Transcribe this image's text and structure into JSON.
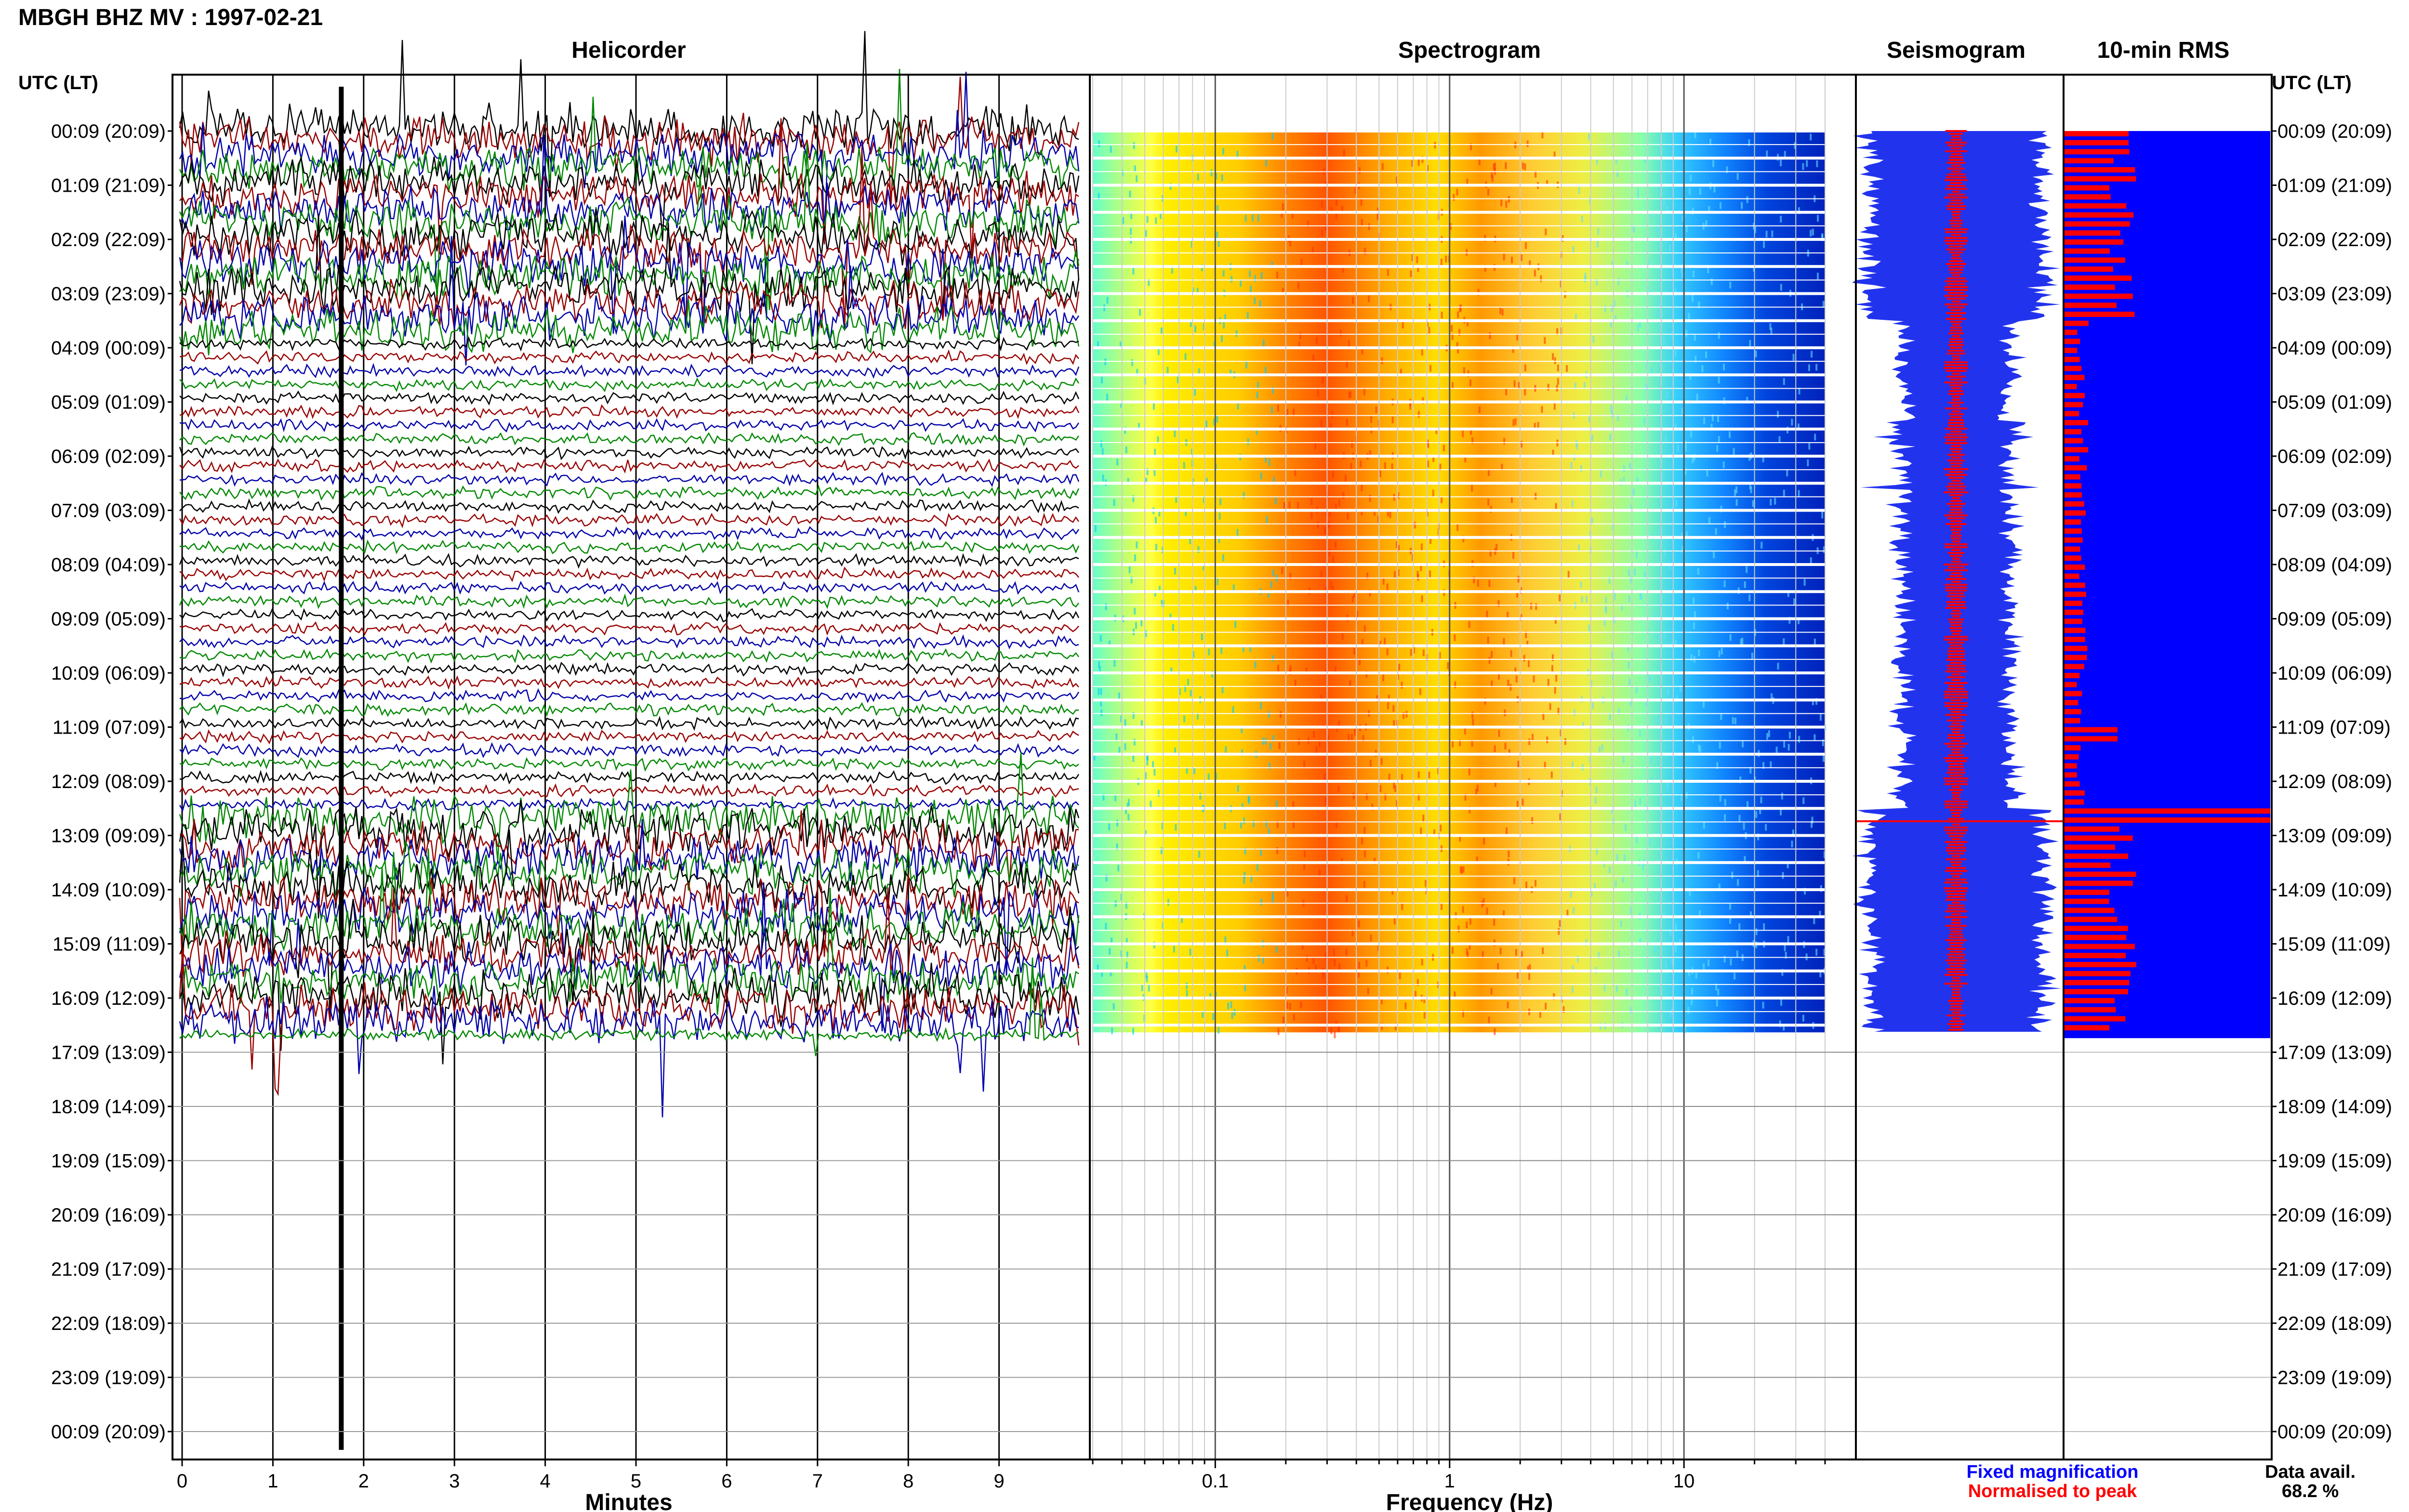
{
  "title": "MBGH BHZ MV : 1997-02-21",
  "time_axis_label": "UTC (LT)",
  "chart_data": [
    {
      "type": "line",
      "title": "Helicorder",
      "xlabel": "Minutes",
      "xlim": [
        0,
        10
      ],
      "xticks": [
        "0",
        "1",
        "2",
        "3",
        "4",
        "5",
        "6",
        "7",
        "8",
        "9"
      ],
      "row_labels": [
        "00:09 (20:09)",
        "01:09 (21:09)",
        "02:09 (22:09)",
        "03:09 (23:09)",
        "04:09 (00:09)",
        "05:09 (01:09)",
        "06:09 (02:09)",
        "07:09 (03:09)",
        "08:09 (04:09)",
        "09:09 (05:09)",
        "10:09 (06:09)",
        "11:09 (07:09)",
        "12:09 (08:09)",
        "13:09 (09:09)",
        "14:09 (10:09)",
        "15:09 (11:09)",
        "16:09 (12:09)",
        "17:09 (13:09)",
        "18:09 (14:09)",
        "19:09 (15:09)",
        "20:09 (16:09)",
        "21:09 (17:09)",
        "22:09 (18:09)",
        "23:09 (19:09)",
        "00:09 (20:09)"
      ],
      "trace_colors": [
        "#000000",
        "#990000",
        "#0000aa",
        "#008800"
      ],
      "data_end_hour": 16.5
    },
    {
      "type": "heatmap",
      "title": "Spectrogram",
      "xlabel": "Frequency (Hz)",
      "xscale": "log",
      "xlim": [
        0.03,
        40
      ],
      "xticks": [
        "0.1",
        "1",
        "10"
      ],
      "colormap": [
        "#0033cc",
        "#00bbff",
        "#66ffcc",
        "#ffff33",
        "#ff8800",
        "#dd0000"
      ]
    },
    {
      "type": "line",
      "title": "Seismogram",
      "legend": [
        {
          "name": "Fixed magnification",
          "color": "#0000ff"
        },
        {
          "name": "Normalised to peak",
          "color": "#ff0000"
        }
      ]
    },
    {
      "type": "bar",
      "title": "10-min RMS",
      "bar_colors": {
        "background": "#0000ff",
        "bars": "#ff0000"
      }
    }
  ],
  "data_availability": {
    "label": "Data avail.",
    "value": "68.2 %"
  }
}
